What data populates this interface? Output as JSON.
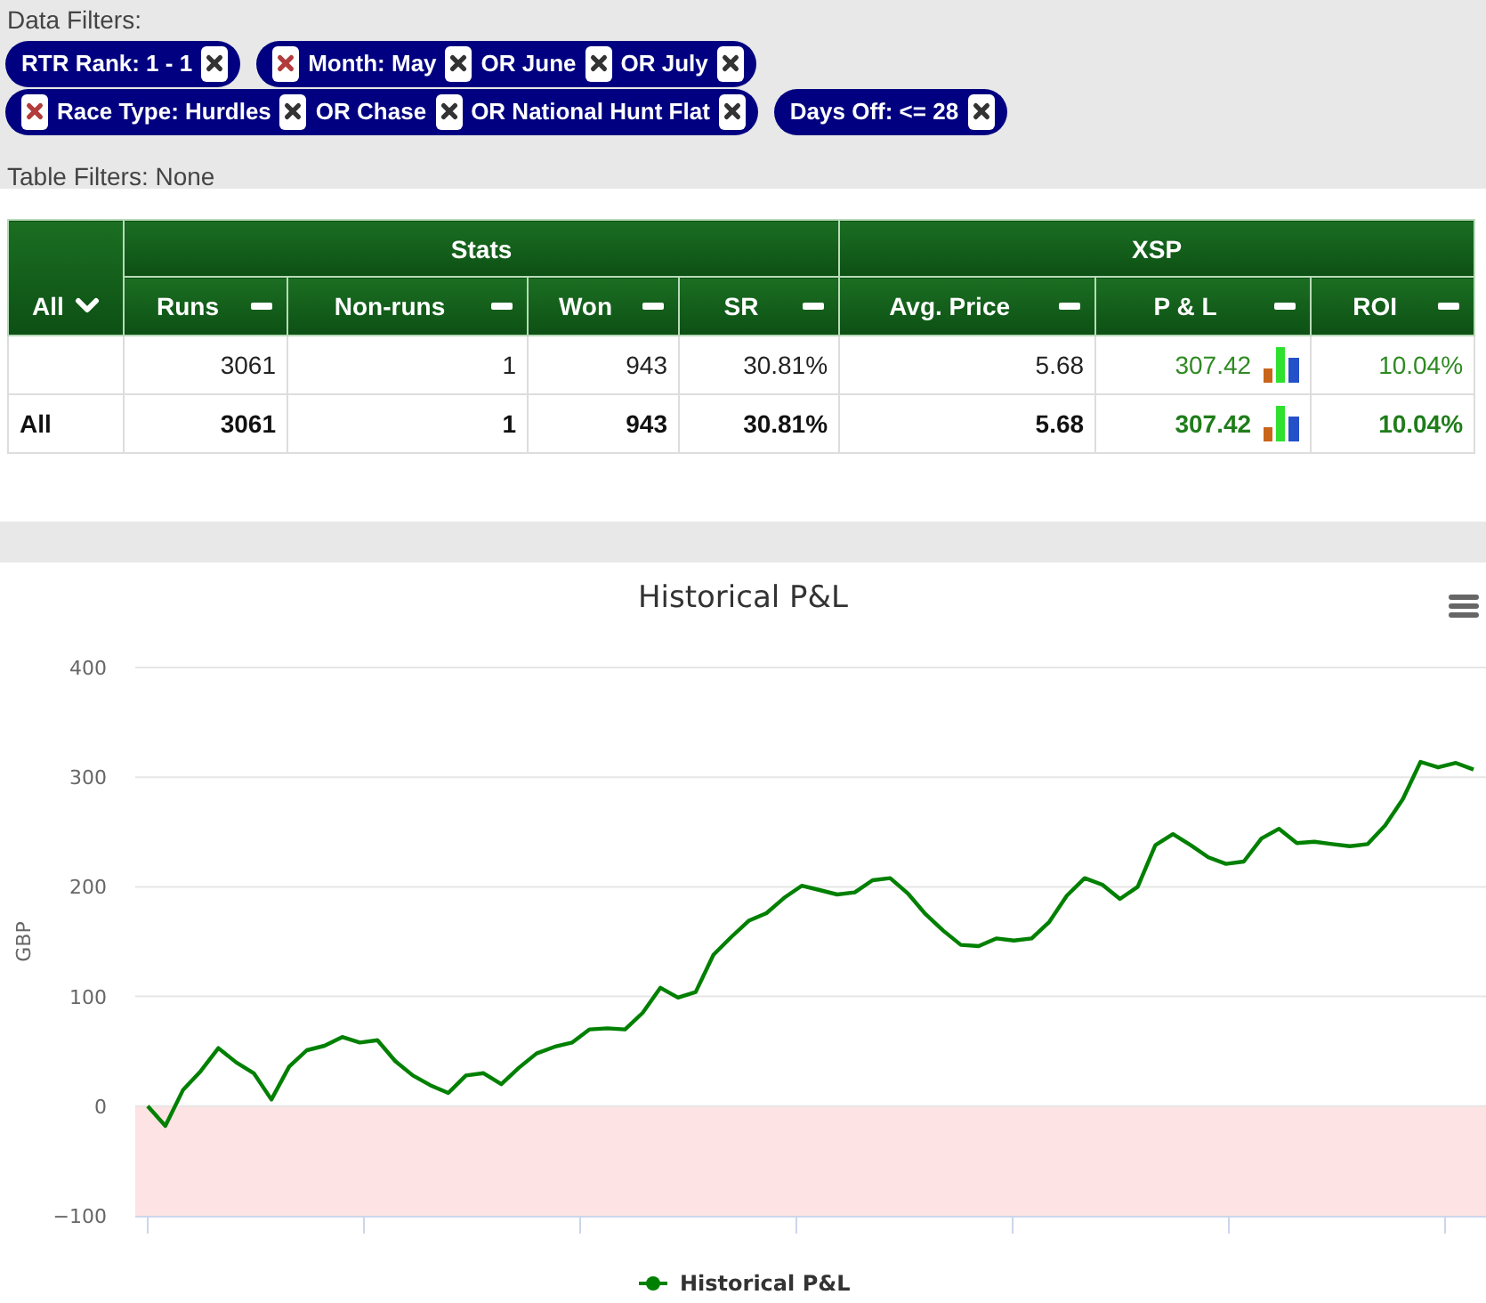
{
  "data_filters": {
    "label": "Data Filters:",
    "filters": [
      {
        "clear_all": false,
        "terms": [
          "RTR Rank: 1 - 1"
        ]
      },
      {
        "clear_all": true,
        "terms": [
          "Month: May",
          "OR June",
          "OR July"
        ]
      },
      {
        "clear_all": true,
        "terms": [
          "Race Type: Hurdles",
          "OR Chase",
          "OR National Hunt Flat"
        ]
      },
      {
        "clear_all": false,
        "terms": [
          "Days Off: <= 28"
        ]
      }
    ]
  },
  "table_filters": {
    "text": "Table Filters: None"
  },
  "table": {
    "row_header": {
      "label": "All"
    },
    "column_groups": [
      {
        "label": "Stats",
        "columns": [
          {
            "label": "Runs",
            "kind": "plain"
          },
          {
            "label": "Non-runs",
            "kind": "plain"
          },
          {
            "label": "Won",
            "kind": "plain"
          },
          {
            "label": "SR",
            "kind": "plain"
          }
        ]
      },
      {
        "label": "XSP",
        "columns": [
          {
            "label": "Avg. Price",
            "kind": "plain"
          },
          {
            "label": "P & L",
            "kind": "profit_chart"
          },
          {
            "label": "ROI",
            "kind": "profit"
          }
        ]
      }
    ],
    "rows": [
      {
        "kind": "data",
        "cells": [
          "3061",
          "1",
          "943",
          "30.81%",
          "5.68",
          "307.42",
          "10.04%"
        ]
      },
      {
        "kind": "total",
        "label": "All",
        "cells": [
          "3061",
          "1",
          "943",
          "30.81%",
          "5.68",
          "307.42",
          "10.04%"
        ]
      }
    ]
  },
  "chart": {
    "chart_data": {
      "type": "line",
      "title": "Historical P&L",
      "ylabel": "GBP",
      "ylim": [
        -100,
        400
      ],
      "yticks": [
        {
          "value": -100,
          "label": "−100"
        },
        0,
        100,
        200,
        300,
        400
      ],
      "grid": true,
      "bands": [
        {
          "axis": "y",
          "from": -100,
          "to": 0,
          "color": "#fde3e3"
        }
      ],
      "series": [
        {
          "name": "Historical P&L",
          "color": "#008000",
          "values": [
            0,
            -18,
            15,
            32,
            53,
            40,
            30,
            6,
            36,
            51,
            55,
            63,
            58,
            60,
            41,
            28,
            19,
            12,
            28,
            30,
            20,
            35,
            48,
            54,
            58,
            70,
            71,
            70,
            85,
            108,
            99,
            104,
            138,
            154,
            169,
            176,
            190,
            201,
            197,
            193,
            195,
            206,
            208,
            194,
            175,
            160,
            147,
            146,
            153,
            151,
            153,
            168,
            192,
            208,
            202,
            189,
            200,
            238,
            248,
            238,
            227,
            221,
            223,
            244,
            253,
            240,
            241,
            239,
            237,
            239,
            256,
            280,
            314,
            309,
            313,
            307
          ]
        }
      ]
    }
  }
}
